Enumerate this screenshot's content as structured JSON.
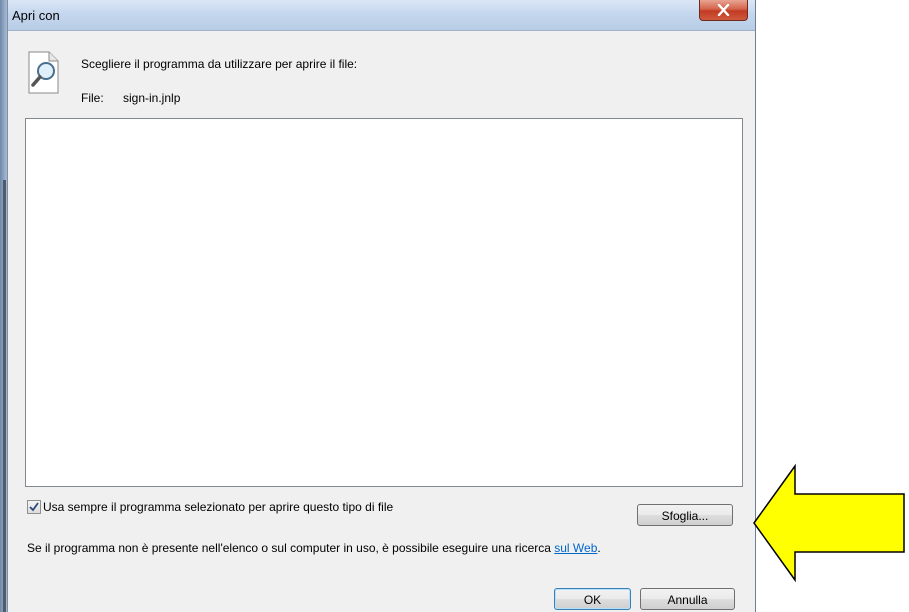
{
  "window": {
    "title": "Apri con",
    "close_icon": "close-icon"
  },
  "header": {
    "prompt": "Scegliere il programma da utilizzare per aprire il file:",
    "file_label": "File:",
    "file_name": "sign-in.jnlp"
  },
  "options": {
    "always_use_label": "Usa sempre il programma selezionato per aprire questo tipo di file",
    "always_use_checked": true,
    "browse_label": "Sfoglia..."
  },
  "hint": {
    "text": "Se il programma non è presente nell'elenco o sul computer in uso, è possibile eseguire una ricerca ",
    "link": "sul Web",
    "end": "."
  },
  "buttons": {
    "ok": "OK",
    "cancel": "Annulla"
  },
  "colors": {
    "arrow_fill": "#ffff00",
    "link": "#0066cc",
    "close_red": "#c13b22"
  }
}
